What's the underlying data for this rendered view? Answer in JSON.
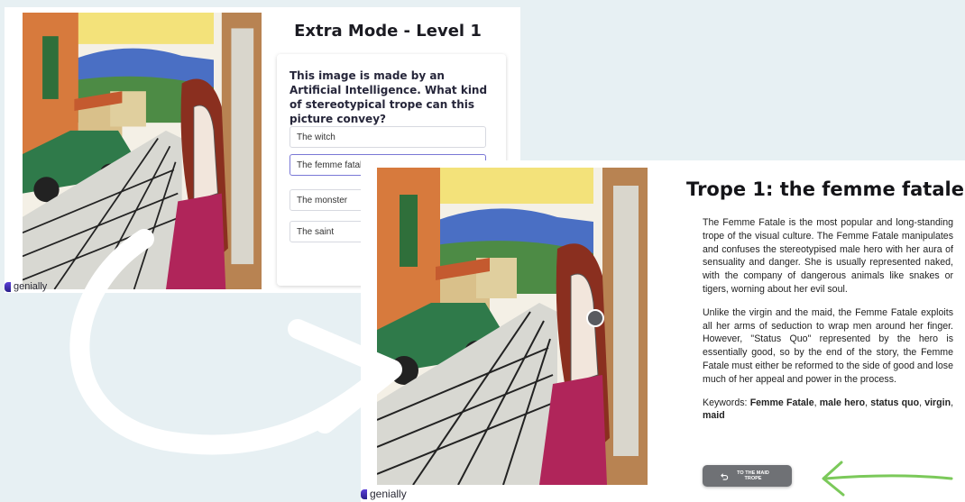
{
  "slide1": {
    "title": "Extra Mode - Level 1",
    "question": "This image is made by an Artificial Intelligence. What kind of stereotypical trope can this picture convey?",
    "options": [
      "The witch",
      "The femme fatale",
      "The monster",
      "The saint"
    ],
    "selected_option": "The femme fatale",
    "brand": "genially"
  },
  "slide2": {
    "title": "Trope 1: the femme fatale",
    "paragraph1": "The Femme Fatale is the most popular and long-standing trope of the visual culture. The Femme Fatale manipulates and confuses the stereotypised male hero with her aura of sensuality and danger. She is usually represented naked, with the company of dangerous animals like snakes or tigers, worning about her evil soul.",
    "paragraph2": "Unlike the virgin and the maid, the Femme Fatale exploits all her arms of seduction to wrap men around her finger. However, \"Status Quo\" represented by the hero is essentially good, so by the end of the story, the Femme Fatale must either be reformed to the side of good and lose much of her appeal and power in the process.",
    "keywords_label": "Keywords:",
    "keywords": [
      "Femme Fatale",
      "male hero",
      "status quo",
      "virgin",
      "maid"
    ],
    "button_label": "TO THE MAID TROPE",
    "brand": "genially"
  },
  "colors": {
    "background": "#e7f0f3",
    "selected_border": "#7a78d6",
    "button": "#6f7175",
    "annotation_arrow": "#7bc95a",
    "brand": "#4b32c8"
  },
  "icons": [
    "undo-icon",
    "genially-logo",
    "curved-arrow",
    "green-arrow"
  ]
}
